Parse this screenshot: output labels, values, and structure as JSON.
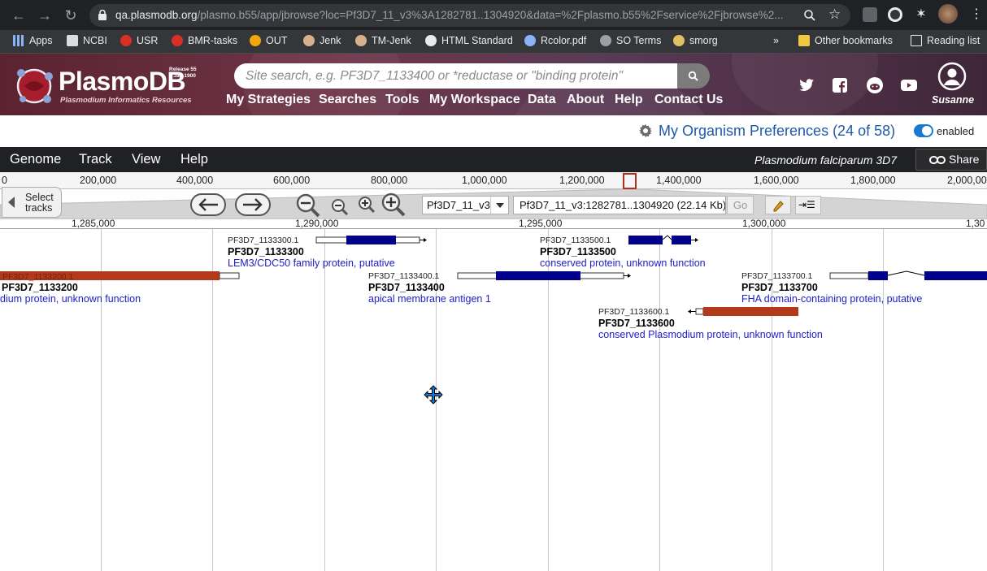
{
  "browser": {
    "url_host": "qa.plasmodb.org",
    "url_rest": "/plasmo.b55/app/jbrowse?loc=Pf3D7_11_v3%3A1282781..1304920&data=%2Fplasmo.b55%2Fservice%2Fjbrowse%2..."
  },
  "bookmarks": [
    {
      "label": "Apps",
      "icon": "apps-grid-icon"
    },
    {
      "label": "NCBI",
      "icon": "ncbi-icon"
    },
    {
      "label": "USR",
      "icon": "usr-icon"
    },
    {
      "label": "BMR-tasks",
      "icon": "bmr-icon"
    },
    {
      "label": "OUT",
      "icon": "out-icon"
    },
    {
      "label": "Jenk",
      "icon": "jenkins-icon"
    },
    {
      "label": "TM-Jenk",
      "icon": "jenkins-icon"
    },
    {
      "label": "HTML Standard",
      "icon": "html-icon"
    },
    {
      "label": "Rcolor.pdf",
      "icon": "r-icon"
    },
    {
      "label": "SO Terms",
      "icon": "globe-icon"
    },
    {
      "label": "smorg",
      "icon": "smorg-icon"
    }
  ],
  "bookmarks_overflow": "»",
  "bookmarks_other": "Other bookmarks",
  "bookmarks_reading": "Reading list",
  "site": {
    "logo": "PlasmoDB",
    "logo_sub": "Plasmodium Informatics Resources",
    "release_line1": "Release 55",
    "release_line2": "1 Jan 1900",
    "search_placeholder": "Site search, e.g. PF3D7_1133400 or *reductase or \"binding protein\"",
    "nav": [
      "My Strategies",
      "Searches",
      "Tools",
      "My Workspace",
      "Data",
      "About",
      "Help",
      "Contact Us"
    ],
    "user": "Susanne"
  },
  "prefs": {
    "label": "My Organism Preferences (24 of 58)",
    "toggle_label": "enabled"
  },
  "jbrowse": {
    "menu": [
      "Genome",
      "Track",
      "View",
      "Help"
    ],
    "organism": "Plasmodium falciparum 3D7",
    "share": "Share",
    "overview_labels": [
      "0",
      "200,000",
      "400,000",
      "600,000",
      "800,000",
      "1,000,000",
      "1,200,000",
      "1,400,000",
      "1,600,000",
      "1,800,000",
      "2,000,000"
    ],
    "select_tracks": "Select tracks",
    "chrom": "Pf3D7_11_v3",
    "location": "Pf3D7_11_v3:1282781..1304920 (22.14 Kb)",
    "go": "Go",
    "ruler_labels": [
      "1,285,000",
      "1,290,000",
      "1,295,000",
      "1,300,000",
      "1,30"
    ]
  },
  "features": [
    {
      "id": "PF3D7_1133300.1",
      "gene": "PF3D7_1133300",
      "desc": "LEM3/CDC50 family protein, putative",
      "strand": "+",
      "color": "#00008b"
    },
    {
      "id": "PF3D7_1133500.1",
      "gene": "PF3D7_1133500",
      "desc": "conserved protein, unknown function",
      "strand": "+",
      "color": "#00008b"
    },
    {
      "id": "PF3D7_1133200.1",
      "gene": "PF3D7_1133200",
      "desc": "dium protein, unknown function",
      "strand": "-",
      "color": "#b23a1a"
    },
    {
      "id": "PF3D7_1133400.1",
      "gene": "PF3D7_1133400",
      "desc": "apical membrane antigen 1",
      "strand": "+",
      "color": "#00008b"
    },
    {
      "id": "PF3D7_1133700.1",
      "gene": "PF3D7_1133700",
      "desc": "FHA domain-containing protein, putative",
      "strand": "+",
      "color": "#00008b"
    },
    {
      "id": "PF3D7_1133600.1",
      "gene": "PF3D7_1133600",
      "desc": "conserved Plasmodium protein, unknown function",
      "strand": "-",
      "color": "#b23a1a"
    }
  ]
}
